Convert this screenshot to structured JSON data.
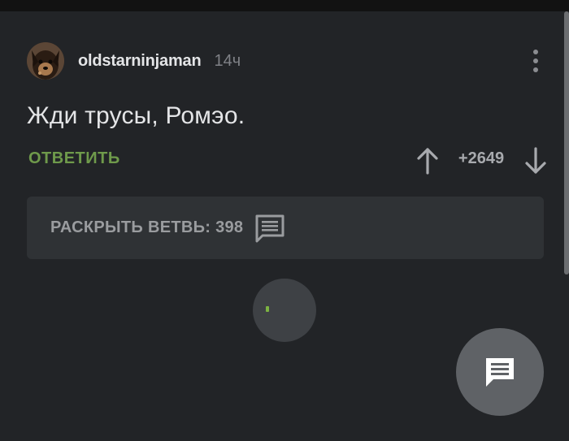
{
  "comment": {
    "username": "oldstarninjaman",
    "timestamp": "14ч",
    "text": "Жди трусы, Ромэо.",
    "reply_label": "ОТВЕТИТЬ",
    "score": "+2649",
    "icons": {
      "avatar": "user-avatar",
      "more": "more-vertical-icon",
      "up": "arrow-up-icon",
      "down": "arrow-down-icon"
    }
  },
  "thread": {
    "expand_label": "РАСКРЫТЬ ВЕТВЬ: 398",
    "icon": "comments-icon"
  },
  "loading": {
    "icon": "loading-spinner"
  },
  "fab": {
    "icon": "comment-icon"
  },
  "colors": {
    "background": "#222427",
    "card": "#2f3235",
    "accent_green": "#6f9a4b",
    "text_primary": "#e4e5e7",
    "text_muted": "#7f8186"
  }
}
